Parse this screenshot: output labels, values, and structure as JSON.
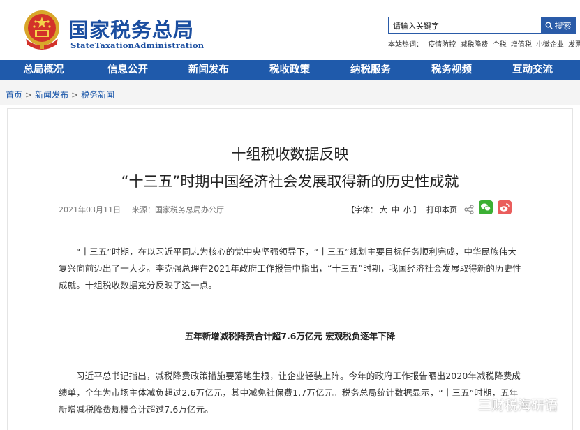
{
  "header": {
    "title": "国家税务总局",
    "subtitle": "StateTaxationAdministration",
    "search_placeholder": "请输入关键字",
    "search_button": "搜索",
    "hot_label": "本站热词：",
    "hot_words": [
      "疫情防控",
      "减税降费",
      "个税",
      "增值税",
      "小微企业",
      "发票"
    ]
  },
  "nav": {
    "items": [
      "总局概况",
      "信息公开",
      "新闻发布",
      "税收政策",
      "纳税服务",
      "税务视频",
      "互动交流"
    ]
  },
  "breadcrumb": {
    "items": [
      "首页",
      "新闻发布",
      "税务新闻"
    ],
    "separator": ">"
  },
  "article": {
    "title_line1": "十组税收数据反映",
    "title_line2": "“十三五”时期中国经济社会发展取得新的历史性成就",
    "date": "2021年03月11日",
    "source": "来源：国家税务总局办公厅",
    "font_label_open": "【字体：",
    "font_sizes": [
      "大",
      "中",
      "小"
    ],
    "font_label_close": "】",
    "print_label": "打印本页",
    "paragraph1": "“十三五”时期，在以习近平同志为核心的党中央坚强领导下，“十三五”规划主要目标任务顺利完成，中华民族伟大复兴向前迈出了一大步。李克强总理在2021年政府工作报告中指出，“十三五”时期，我国经济社会发展取得新的历史性成就。十组税收数据充分反映了这一点。",
    "subheading": "五年新增减税降费合计超7.6万亿元  宏观税负逐年下降",
    "paragraph2": "习近平总书记指出，减税降费政策措施要落地生根，让企业轻装上阵。今年的政府工作报告晒出2020年减税降费成绩单，全年为市场主体减负超过2.6万亿元，其中减免社保费1.7万亿元。税务总局统计数据显示，“十三五”时期，五年新增减税降费规模合计超过7.6万亿元。"
  },
  "watermark": {
    "text": "三财税海研语"
  },
  "colors": {
    "brand_blue": "#1f5aab",
    "wechat_green": "#3cb034",
    "weibo_red": "#ea5d5c"
  }
}
